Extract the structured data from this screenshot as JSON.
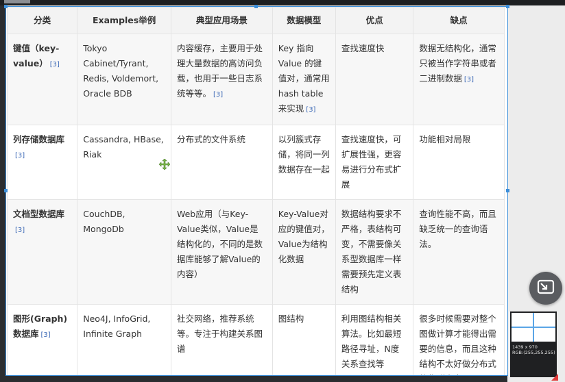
{
  "table": {
    "headers": [
      "分类",
      "Examples举例",
      "典型应用场景",
      "数据模型",
      "优点",
      "缺点"
    ],
    "ref": "[3]",
    "rows": [
      {
        "category": "键值（key-value）",
        "examples": "Tokyo Cabinet/Tyrant, Redis, Voldemort, Oracle BDB",
        "scenario": "内容缓存，主要用于处理大量数据的高访问负载，也用于一些日志系统等等。",
        "model": "Key 指向 Value 的键值对，通常用hash table来实现",
        "pros": "查找速度快",
        "cons": "数据无结构化，通常只被当作字符串或者二进制数据"
      },
      {
        "category": "列存储数据库",
        "examples": "Cassandra, HBase, Riak",
        "scenario": "分布式的文件系统",
        "model": "以列簇式存储，将同一列数据存在一起",
        "pros": "查找速度快，可扩展性强，更容易进行分布式扩展",
        "cons": "功能相对局限"
      },
      {
        "category": "文档型数据库",
        "examples": "CouchDB, MongoDb",
        "scenario": "Web应用（与Key-Value类似，Value是结构化的，不同的是数据库能够了解Value的内容）",
        "model": "Key-Value对应的键值对，Value为结构化数据",
        "pros": "数据结构要求不严格，表结构可变，不需要像关系型数据库一样需要预先定义表结构",
        "cons": "查询性能不高，而且缺乏统一的查询语法。"
      },
      {
        "category": "图形(Graph)数据库",
        "examples": "Neo4J, InfoGrid, Infinite Graph",
        "scenario": "社交网络，推荐系统等。专注于构建关系图谱",
        "model": "图结构",
        "pros": "利用图结构相关算法。比如最短路径寻址，N度关系查找等",
        "cons": "很多时候需要对整个图做计算才能得出需要的信息，而且这种结构不太好做分布式的集群方案。"
      }
    ]
  },
  "magnifier": {
    "size": "1439 x 970",
    "rgb": "RGB:(255,255,255)"
  },
  "colors": {
    "selection": "#3d8fd9",
    "move_cursor": "#7ab648",
    "reference_link": "#3a67b5"
  }
}
